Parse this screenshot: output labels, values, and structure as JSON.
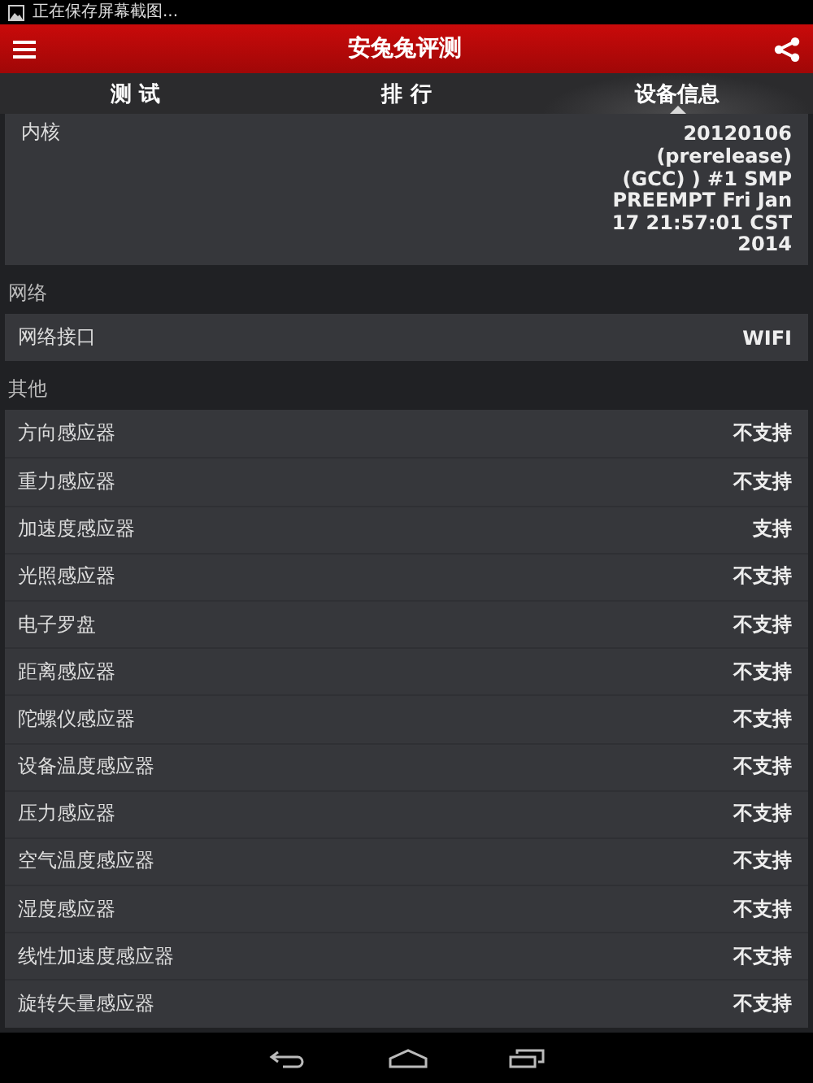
{
  "status_bar": {
    "notification": "正在保存屏幕截图..."
  },
  "app_bar": {
    "title": "安兔兔评测"
  },
  "tabs": [
    {
      "label": "测 试",
      "selected": false
    },
    {
      "label": "排 行",
      "selected": false
    },
    {
      "label": "设备信息",
      "selected": true
    }
  ],
  "kernel": {
    "label": "内核",
    "value_lines": [
      "20120106",
      "(prerelease)",
      "(GCC) ) #1 SMP",
      "PREEMPT Fri Jan",
      "17 21:57:01 CST",
      "2014"
    ]
  },
  "sections": [
    {
      "title": "网络",
      "rows": [
        {
          "label": "网络接口",
          "value": "WIFI"
        }
      ]
    },
    {
      "title": "其他",
      "rows": [
        {
          "label": "方向感应器",
          "value": "不支持"
        },
        {
          "label": "重力感应器",
          "value": "不支持"
        },
        {
          "label": "加速度感应器",
          "value": "支持"
        },
        {
          "label": "光照感应器",
          "value": "不支持"
        },
        {
          "label": "电子罗盘",
          "value": "不支持"
        },
        {
          "label": "距离感应器",
          "value": "不支持"
        },
        {
          "label": "陀螺仪感应器",
          "value": "不支持"
        },
        {
          "label": "设备温度感应器",
          "value": "不支持"
        },
        {
          "label": "压力感应器",
          "value": "不支持"
        },
        {
          "label": "空气温度感应器",
          "value": "不支持"
        },
        {
          "label": "湿度感应器",
          "value": "不支持"
        },
        {
          "label": "线性加速度感应器",
          "value": "不支持"
        },
        {
          "label": "旋转矢量感应器",
          "value": "不支持"
        }
      ]
    }
  ]
}
